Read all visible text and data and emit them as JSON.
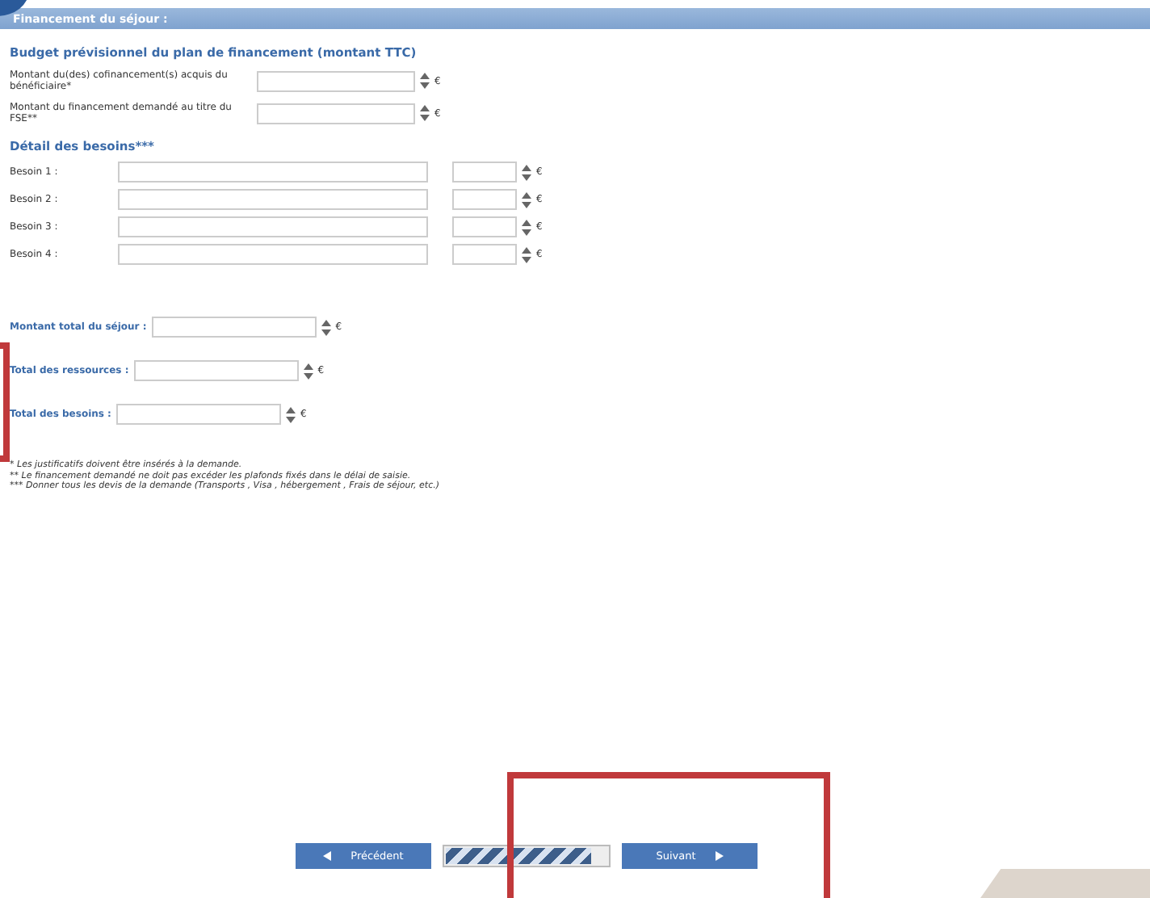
{
  "section": {
    "title": "Financement du séjour :"
  },
  "budget": {
    "heading": "Budget prévisionnel du plan de financement (montant TTC)",
    "rows": [
      {
        "label": "Montant du(des) cofinancement(s) acquis du bénéficiaire*",
        "unit": "€"
      },
      {
        "label": "Montant du financement demandé au titre du FSE**",
        "unit": "€"
      }
    ]
  },
  "needs": {
    "heading": "Détail des besoins***",
    "rows": [
      {
        "label": "Besoin 1 :",
        "unit": "€"
      },
      {
        "label": "Besoin 2 :",
        "unit": "€"
      },
      {
        "label": "Besoin 3 :",
        "unit": "€"
      },
      {
        "label": "Besoin 4 :",
        "unit": "€"
      }
    ]
  },
  "totals": [
    {
      "label": "Montant total du séjour :",
      "unit": "€"
    },
    {
      "label": "Total des ressources :",
      "unit": "€"
    },
    {
      "label": "Total des besoins :",
      "unit": "€"
    }
  ],
  "footnotes": [
    "* Les justificatifs doivent être insérés à la demande.",
    "** Le financement demandé ne doit pas excéder les plafonds fixés dans le délai de saisie.",
    "*** Donner tous les devis de la demande (Transports , Visa , hébergement , Frais de séjour, etc.)"
  ],
  "nav": {
    "previous": "Précédent",
    "next": "Suivant",
    "progress": {
      "level": 0.9
    }
  }
}
